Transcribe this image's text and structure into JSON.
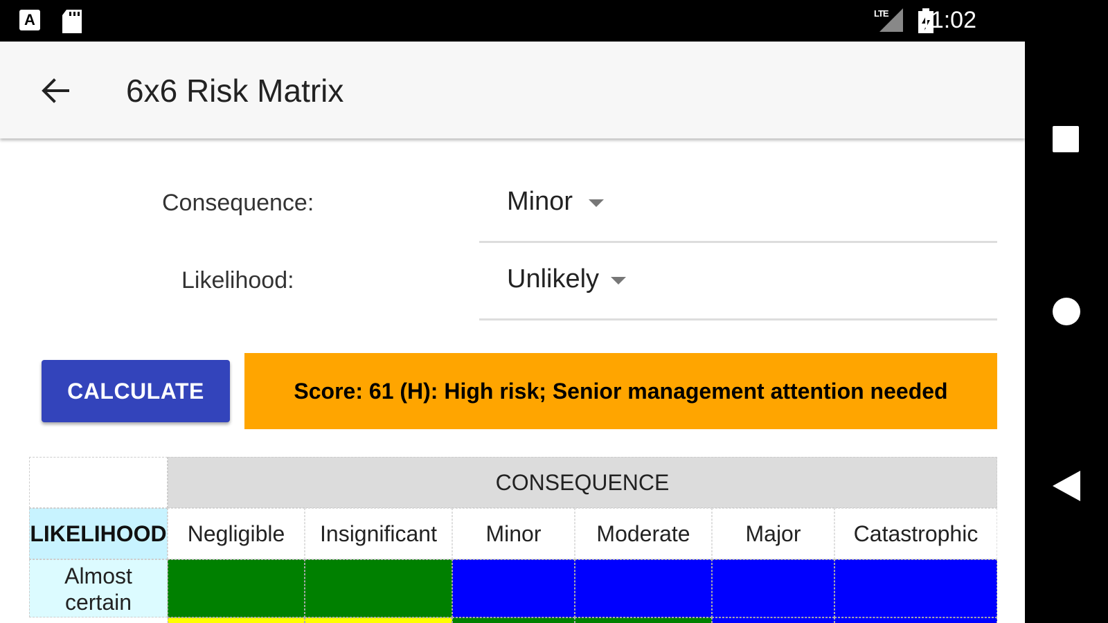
{
  "status_bar": {
    "time": "11:02",
    "lte": "LTE",
    "icons": [
      "a-notification-icon",
      "sd-card-icon",
      "signal-icon",
      "battery-charging-icon"
    ]
  },
  "app_bar": {
    "title": "6x6 Risk Matrix",
    "back_icon": "arrow-back-icon"
  },
  "form": {
    "consequence_label": "Consequence:",
    "consequence_value": "Minor",
    "likelihood_label": "Likelihood:",
    "likelihood_value": "Unlikely"
  },
  "calculate_label": "CALCULATE",
  "result": {
    "text": "Score: 61 (H): High risk; Senior management attention needed",
    "color": "#ffa500"
  },
  "matrix": {
    "consequence_header": "CONSEQUENCE",
    "likelihood_header": "LIKELIHOOD",
    "columns": [
      "Negligible",
      "Insignificant",
      "Minor",
      "Moderate",
      "Major",
      "Catastrophic"
    ],
    "rows": [
      {
        "label": [
          "Almost",
          "certain"
        ],
        "colors": [
          "#008000",
          "#008000",
          "#0000ff",
          "#0000ff",
          "#0000ff",
          "#0000ff"
        ]
      },
      {
        "label": [
          "",
          ""
        ],
        "colors": [
          "#ffff00",
          "#ffff00",
          "#008000",
          "#008000",
          "#0000ff",
          "#0000ff"
        ]
      }
    ]
  },
  "nav_bar": {
    "icons": [
      "recents-square-icon",
      "home-circle-icon",
      "back-triangle-icon"
    ]
  },
  "colors": {
    "primary_button": "#3344bb",
    "appbar_bg": "#f7f7f7",
    "likelihood_bg": "#c8f3ff"
  }
}
